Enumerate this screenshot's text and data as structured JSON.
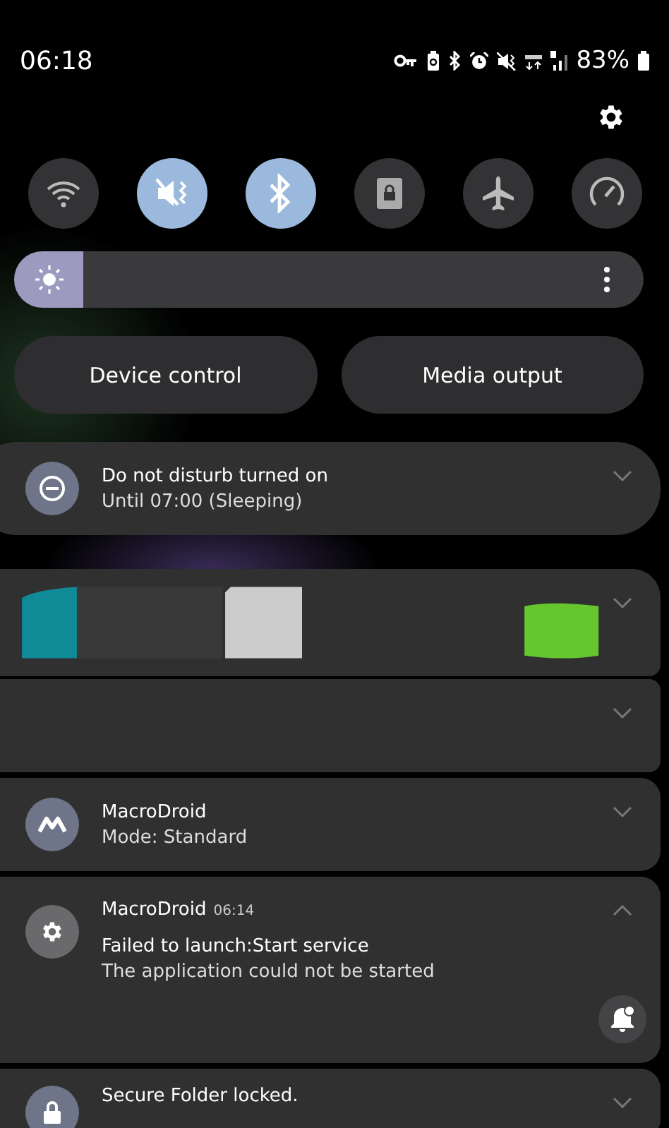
{
  "status_bar": {
    "time": "06:18",
    "battery": "83%"
  },
  "quick_toggles": [
    {
      "kind": "wifi",
      "on": false
    },
    {
      "kind": "mute",
      "on": true
    },
    {
      "kind": "bluetooth",
      "on": true
    },
    {
      "kind": "secure-folder",
      "on": false
    },
    {
      "kind": "airplane",
      "on": false
    },
    {
      "kind": "power-mode",
      "on": false
    }
  ],
  "brightness": {
    "level": 0.11
  },
  "buttons": [
    "Device control",
    "Media output"
  ],
  "notifications": [
    {
      "kind": "dnd",
      "title": "Do not disturb turned on",
      "text": "Until 07:00 (Sleeping)",
      "expanded": false
    },
    {
      "kind": "redacted",
      "expanded": false
    },
    {
      "kind": "empty",
      "expanded": false
    },
    {
      "kind": "macro",
      "title": "MacroDroid",
      "text": "Mode: Standard",
      "expanded": false
    },
    {
      "kind": "gear",
      "title": "MacroDroid",
      "time": "06:14",
      "lines": [
        "Failed to launch:Start service",
        "The application could not be started"
      ],
      "expanded": true
    },
    {
      "kind": "lock",
      "title": "Secure Folder locked.",
      "expanded": false
    }
  ]
}
